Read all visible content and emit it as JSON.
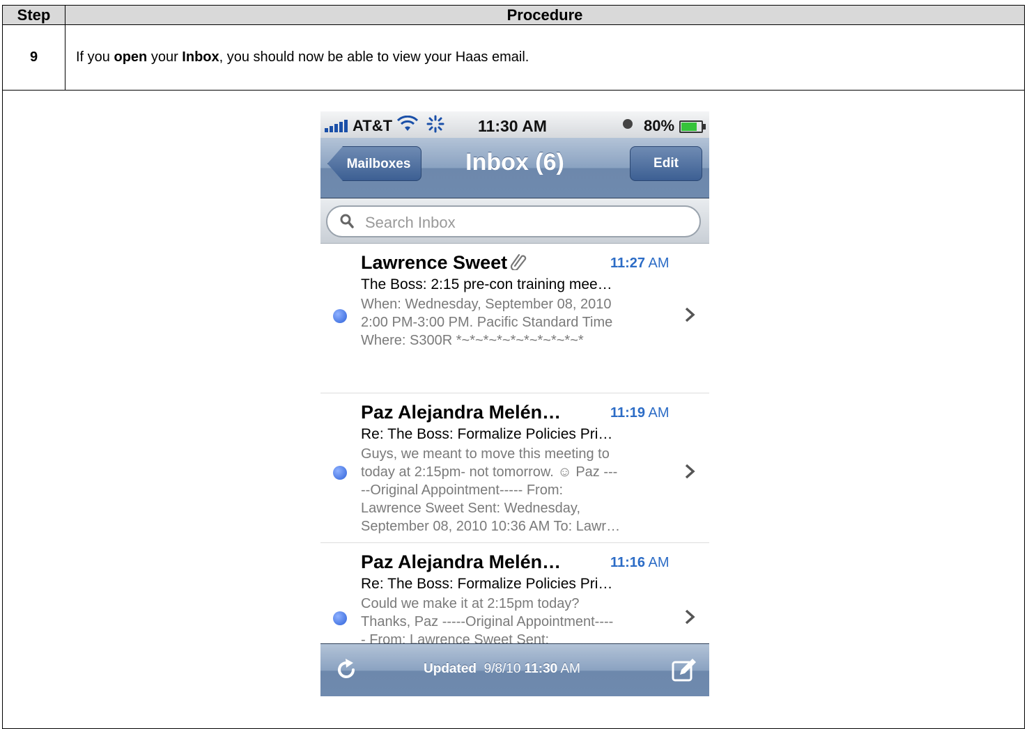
{
  "doc": {
    "header_step": "Step",
    "header_procedure": "Procedure",
    "step_number": "9",
    "instruction": {
      "part1": "If you ",
      "bold1": "open",
      "part2": " your ",
      "bold2": "Inbox",
      "part3": ", you should now be able to view your Haas email."
    }
  },
  "phone": {
    "status_bar": {
      "carrier": "AT&T",
      "time": "11:30 AM",
      "battery": "80%",
      "battery_level": 0.8
    },
    "nav": {
      "back_label": "Mailboxes",
      "title": "Inbox (6)",
      "edit_label": "Edit"
    },
    "search": {
      "placeholder": "Search Inbox"
    },
    "messages": [
      {
        "sender": "Lawrence Sweet",
        "time": "11:27",
        "ampm": "AM",
        "subject": "The Boss: 2:15 pre-con training mee…",
        "preview": [
          "When: Wednesday, September 08, 2010",
          "2:00 PM-3:00 PM. Pacific Standard Time",
          "Where: S300R *~*~*~*~*~*~*~*~*~*"
        ],
        "has_attachment": true
      },
      {
        "sender": "Paz Alejandra Melén…",
        "time": "11:19",
        "ampm": "AM",
        "subject": "Re: The Boss: Formalize Policies Pri…",
        "preview": [
          "Guys, we meant to move this meeting to",
          "today at 2:15pm- not tomorrow. ☺ Paz ---",
          "--Original Appointment----- From:",
          "Lawrence Sweet Sent: Wednesday,",
          "September 08, 2010 10:36 AM To: Lawr…"
        ]
      },
      {
        "sender": "Paz Alejandra Melén…",
        "time": "11:16",
        "ampm": "AM",
        "subject": "Re: The Boss: Formalize Policies Pri…",
        "preview": [
          "Could we make it at 2:15pm today?",
          "Thanks, Paz -----Original Appointment----",
          "- From: Lawrence Sweet Sent:"
        ]
      }
    ],
    "toolbar": {
      "updated_label": "Updated",
      "updated_date": "9/8/10",
      "updated_time": "11:30",
      "updated_ampm": "AM"
    }
  }
}
